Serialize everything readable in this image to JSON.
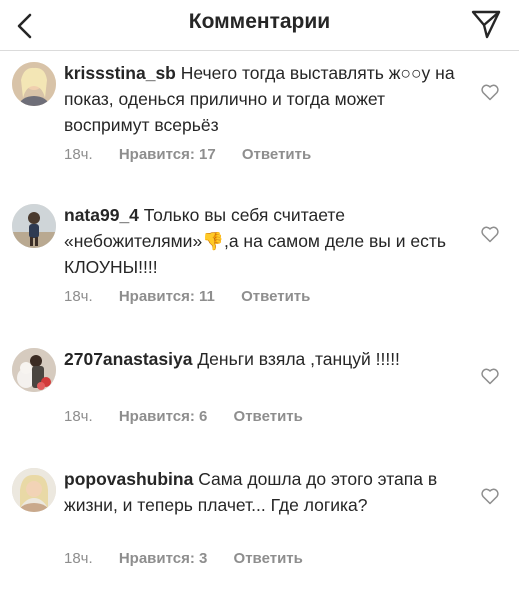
{
  "header": {
    "title": "Комментарии",
    "back_icon": "chevron-left-icon",
    "direct_icon": "paper-plane-icon"
  },
  "comments": [
    {
      "username": "krissstina_sb",
      "text": "Нечего тогда выставлять ж○○у на показ, оденься прилично и тогда может воспримут всерьёз",
      "time": "18ч.",
      "likes": "Нравится: 17",
      "reply": "Ответить"
    },
    {
      "username": "nata99_4",
      "text": "Только вы себя считаете «небожителями»👎,а на самом деле вы и есть КЛОУНЫ!!!!",
      "time": "18ч.",
      "likes": "Нравится: 11",
      "reply": "Ответить"
    },
    {
      "username": "2707anastasiya",
      "text": "Деньги взяла ,танцуй !!!!!",
      "time": "18ч.",
      "likes": "Нравится: 6",
      "reply": "Ответить"
    },
    {
      "username": "popovashubina",
      "text": "Сама дошла до этого этапа в жизни, и теперь плачет... Где логика?",
      "time": "18ч.",
      "likes": "Нравится: 3",
      "reply": "Ответить"
    }
  ],
  "colors": {
    "text": "#262626",
    "secondary": "#8e8e8e",
    "divider": "#dbdbdb"
  }
}
